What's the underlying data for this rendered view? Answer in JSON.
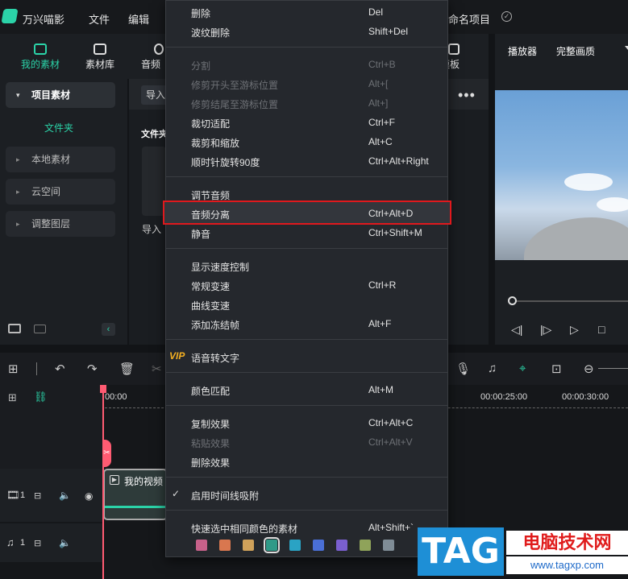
{
  "app": {
    "name": "万兴喵影",
    "project_name": "命名项目"
  },
  "menubar": {
    "file": "文件",
    "edit": "编辑"
  },
  "tabs": [
    {
      "label": "我的素材",
      "active": true
    },
    {
      "label": "素材库",
      "active": false
    },
    {
      "label": "音频",
      "active": false
    },
    {
      "label": "模板",
      "active": false
    }
  ],
  "sidebar": {
    "project_media": "项目素材",
    "folder": "文件夹",
    "items": [
      "本地素材",
      "云空间",
      "调整图层"
    ]
  },
  "media": {
    "import_button": "导入",
    "folder_header": "文件夹",
    "import_label": "导入"
  },
  "preview": {
    "label": "播放器",
    "quality": "完整画质"
  },
  "timeline": {
    "times": [
      "00:00",
      "00:00:25:00",
      "00:00:30:00"
    ],
    "clip_label": "我的视频",
    "video_track": "1",
    "audio_track": "1"
  },
  "context_menu": [
    {
      "label": "删除",
      "shortcut": "Del",
      "disabled": false
    },
    {
      "label": "波纹删除",
      "shortcut": "Shift+Del",
      "disabled": false
    },
    {
      "label": "分割",
      "shortcut": "Ctrl+B",
      "disabled": true
    },
    {
      "label": "修剪开头至游标位置",
      "shortcut": "Alt+[",
      "disabled": true
    },
    {
      "label": "修剪结尾至游标位置",
      "shortcut": "Alt+]",
      "disabled": true
    },
    {
      "label": "裁切适配",
      "shortcut": "Ctrl+F",
      "disabled": false
    },
    {
      "label": "裁剪和缩放",
      "shortcut": "Alt+C",
      "disabled": false
    },
    {
      "label": "顺时针旋转90度",
      "shortcut": "Ctrl+Alt+Right",
      "disabled": false
    },
    {
      "label": "调节音频",
      "shortcut": "",
      "disabled": false
    },
    {
      "label": "音频分离",
      "shortcut": "Ctrl+Alt+D",
      "disabled": false,
      "highlighted": true
    },
    {
      "label": "静音",
      "shortcut": "Ctrl+Shift+M",
      "disabled": false
    },
    {
      "label": "显示速度控制",
      "shortcut": "",
      "disabled": false
    },
    {
      "label": "常规变速",
      "shortcut": "Ctrl+R",
      "disabled": false
    },
    {
      "label": "曲线变速",
      "shortcut": "",
      "disabled": false
    },
    {
      "label": "添加冻结帧",
      "shortcut": "Alt+F",
      "disabled": false
    },
    {
      "label": "语音转文字",
      "shortcut": "",
      "disabled": false,
      "badge": "VIP"
    },
    {
      "label": "颜色匹配",
      "shortcut": "Alt+M",
      "disabled": false
    },
    {
      "label": "复制效果",
      "shortcut": "Ctrl+Alt+C",
      "disabled": false
    },
    {
      "label": "粘贴效果",
      "shortcut": "Ctrl+Alt+V",
      "disabled": true
    },
    {
      "label": "删除效果",
      "shortcut": "",
      "disabled": false
    },
    {
      "label": "启用时间线吸附",
      "shortcut": "",
      "disabled": false,
      "checked": true
    },
    {
      "label": "快速选中相同颜色的素材",
      "shortcut": "Alt+Shift+`",
      "disabled": false
    }
  ],
  "color_swatches": [
    "#c7618a",
    "#d9774f",
    "#cfa15a",
    "#2f9a88",
    "#2aa3c4",
    "#4a6fd6",
    "#7a5fd0",
    "#8fa35a",
    "#7f8c96"
  ],
  "watermark": {
    "tag": "TAG",
    "site_name": "电脑技术网",
    "url": "www.tagxp.com"
  }
}
